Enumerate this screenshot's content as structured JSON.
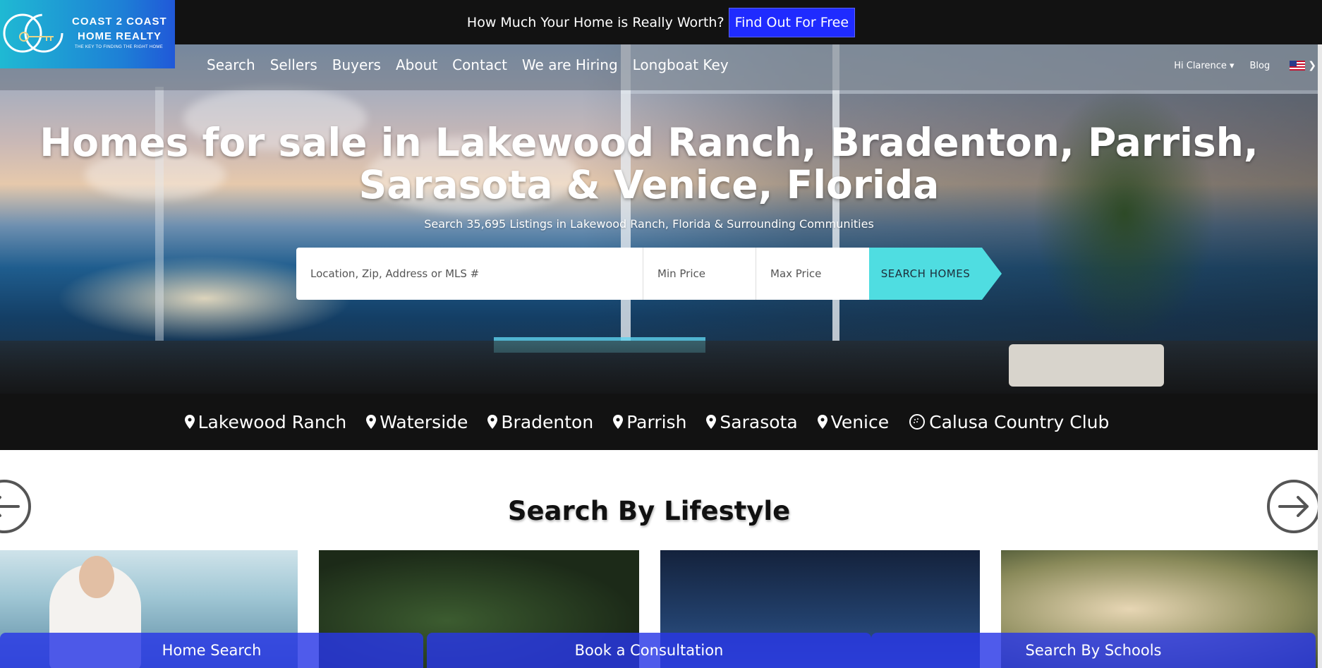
{
  "promo": {
    "text": "How Much Your Home is Really Worth?",
    "button": "Find Out For Free"
  },
  "logo": {
    "line1": "COAST 2 COAST",
    "line2": "HOME REALTY",
    "tagline": "THE KEY TO FINDING THE RIGHT HOME"
  },
  "nav": {
    "links": [
      "Search",
      "Sellers",
      "Buyers",
      "About",
      "Contact",
      "We are Hiring",
      "Longboat Key"
    ],
    "user": "Hi Clarence",
    "blog": "Blog",
    "language_icon": "us-flag-icon"
  },
  "hero": {
    "headline": "Homes for sale in Lakewood Ranch, Bradenton, Parrish, Sarasota & Venice, Florida",
    "subheadline": "Search 35,695 Listings in Lakewood Ranch, Florida & Surrounding Communities"
  },
  "search": {
    "location_placeholder": "Location, Zip, Address or MLS #",
    "min_placeholder": "Min Price",
    "max_placeholder": "Max Price",
    "button": "SEARCH HOMES"
  },
  "cities": [
    {
      "label": "Lakewood Ranch",
      "icon": "map-pin-icon"
    },
    {
      "label": "Waterside",
      "icon": "map-pin-icon"
    },
    {
      "label": "Bradenton",
      "icon": "map-pin-icon"
    },
    {
      "label": "Parrish",
      "icon": "map-pin-icon"
    },
    {
      "label": "Sarasota",
      "icon": "map-pin-icon"
    },
    {
      "label": "Venice",
      "icon": "map-pin-icon"
    },
    {
      "label": "Calusa Country Club",
      "icon": "golf-ball-icon"
    }
  ],
  "lifestyle": {
    "title": "Search By Lifestyle"
  },
  "actions": {
    "home_search": "Home Search",
    "consultation": "Book a Consultation",
    "schools": "Search By Schools"
  },
  "colors": {
    "accent": "#4fdde1",
    "promo_button": "#1f2bff",
    "action_bar": "#2837e6"
  }
}
